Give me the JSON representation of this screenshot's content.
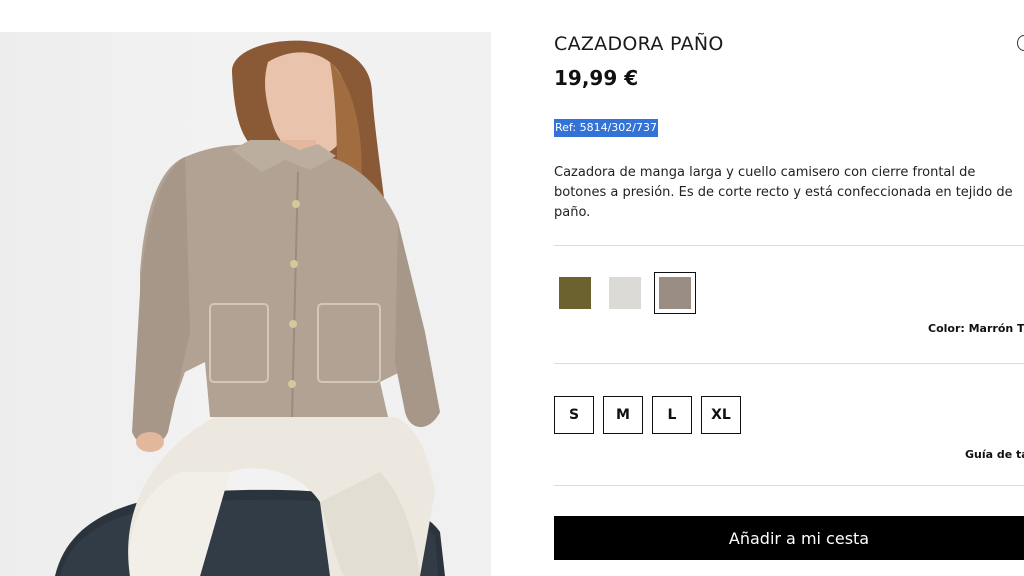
{
  "product": {
    "title": "CAZADORA PAÑO",
    "price": "19,99 €",
    "ref": "Ref: 5814/302/737",
    "description": "Cazadora de manga larga y cuello camisero con cierre frontal de\nbotones a presión. Es de corte recto y está confeccionada en tejido de\npaño."
  },
  "colors": {
    "swatches": [
      {
        "name": "olive",
        "hex": "#6b6230",
        "selected": false
      },
      {
        "name": "light-grey",
        "hex": "#dcdad6",
        "selected": false
      },
      {
        "name": "brown-taupe",
        "hex": "#9a8d83",
        "selected": true
      }
    ],
    "label": "Color: Marrón T"
  },
  "sizes": {
    "options": [
      "S",
      "M",
      "L",
      "XL"
    ],
    "guide_label": "Guía de ta"
  },
  "cart": {
    "add_label": "Añadir a mi cesta"
  },
  "icons": {
    "wishlist": "heart-icon"
  },
  "theme": {
    "accent": "#000000",
    "selection_highlight": "#3372d6"
  }
}
